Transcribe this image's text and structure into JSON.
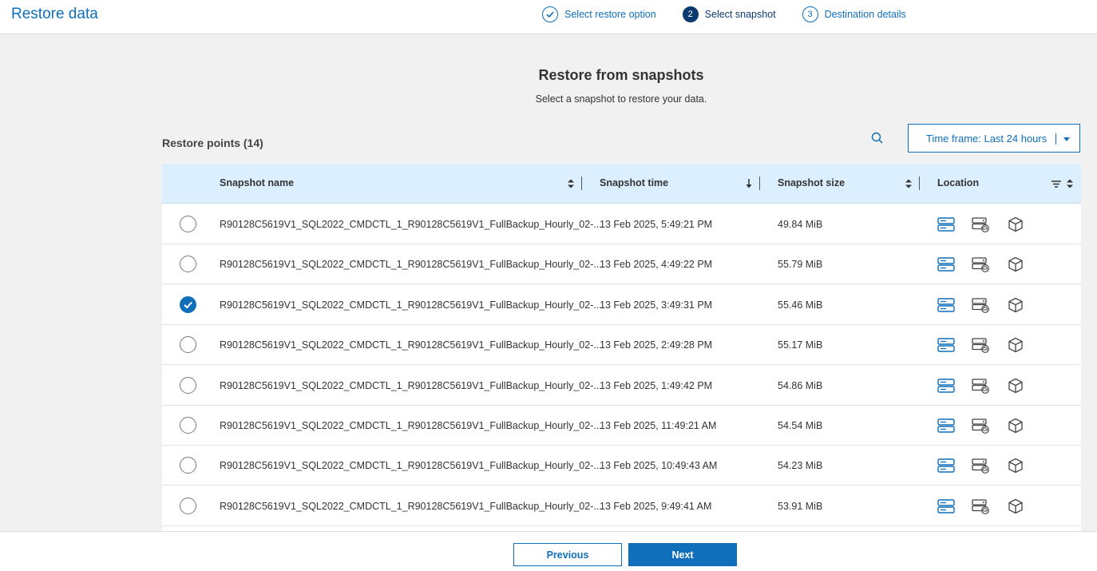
{
  "header": {
    "title": "Restore data",
    "steps": [
      {
        "number": "1",
        "label": "Select restore option",
        "state": "done"
      },
      {
        "number": "2",
        "label": "Select snapshot",
        "state": "active"
      },
      {
        "number": "3",
        "label": "Destination details",
        "state": "pending"
      }
    ]
  },
  "main": {
    "heading": "Restore from snapshots",
    "subheading": "Select a snapshot to restore your data.",
    "restore_points_label": "Restore points (14)",
    "timeframe_label": "Time frame: Last 24 hours"
  },
  "table": {
    "columns": [
      "Snapshot name",
      "Snapshot time",
      "Snapshot size",
      "Location"
    ],
    "rows": [
      {
        "name": "R90128C5619V1_SQL2022_CMDCTL_1_R90128C5619V1_FullBackup_Hourly_02-...",
        "time": "13 Feb 2025, 5:49:21 PM",
        "size": "49.84 MiB",
        "selected": false
      },
      {
        "name": "R90128C5619V1_SQL2022_CMDCTL_1_R90128C5619V1_FullBackup_Hourly_02-...",
        "time": "13 Feb 2025, 4:49:22 PM",
        "size": "55.79 MiB",
        "selected": false
      },
      {
        "name": "R90128C5619V1_SQL2022_CMDCTL_1_R90128C5619V1_FullBackup_Hourly_02-...",
        "time": "13 Feb 2025, 3:49:31 PM",
        "size": "55.46 MiB",
        "selected": true
      },
      {
        "name": "R90128C5619V1_SQL2022_CMDCTL_1_R90128C5619V1_FullBackup_Hourly_02-...",
        "time": "13 Feb 2025, 2:49:28 PM",
        "size": "55.17 MiB",
        "selected": false
      },
      {
        "name": "R90128C5619V1_SQL2022_CMDCTL_1_R90128C5619V1_FullBackup_Hourly_02-...",
        "time": "13 Feb 2025, 1:49:42 PM",
        "size": "54.86 MiB",
        "selected": false
      },
      {
        "name": "R90128C5619V1_SQL2022_CMDCTL_1_R90128C5619V1_FullBackup_Hourly_02-...",
        "time": "13 Feb 2025, 11:49:21 AM",
        "size": "54.54 MiB",
        "selected": false
      },
      {
        "name": "R90128C5619V1_SQL2022_CMDCTL_1_R90128C5619V1_FullBackup_Hourly_02-...",
        "time": "13 Feb 2025, 10:49:43 AM",
        "size": "54.23 MiB",
        "selected": false
      },
      {
        "name": "R90128C5619V1_SQL2022_CMDCTL_1_R90128C5619V1_FullBackup_Hourly_02-...",
        "time": "13 Feb 2025, 9:49:41 AM",
        "size": "53.91 MiB",
        "selected": false
      }
    ],
    "location_icons": [
      "local-storage-icon",
      "cloud-server-icon",
      "object-store-icon"
    ]
  },
  "footer": {
    "previous_label": "Previous",
    "next_label": "Next"
  },
  "colors": {
    "accent": "#0f6fba",
    "active_step": "#0b3a70",
    "table_header_bg": "#dcefff"
  }
}
